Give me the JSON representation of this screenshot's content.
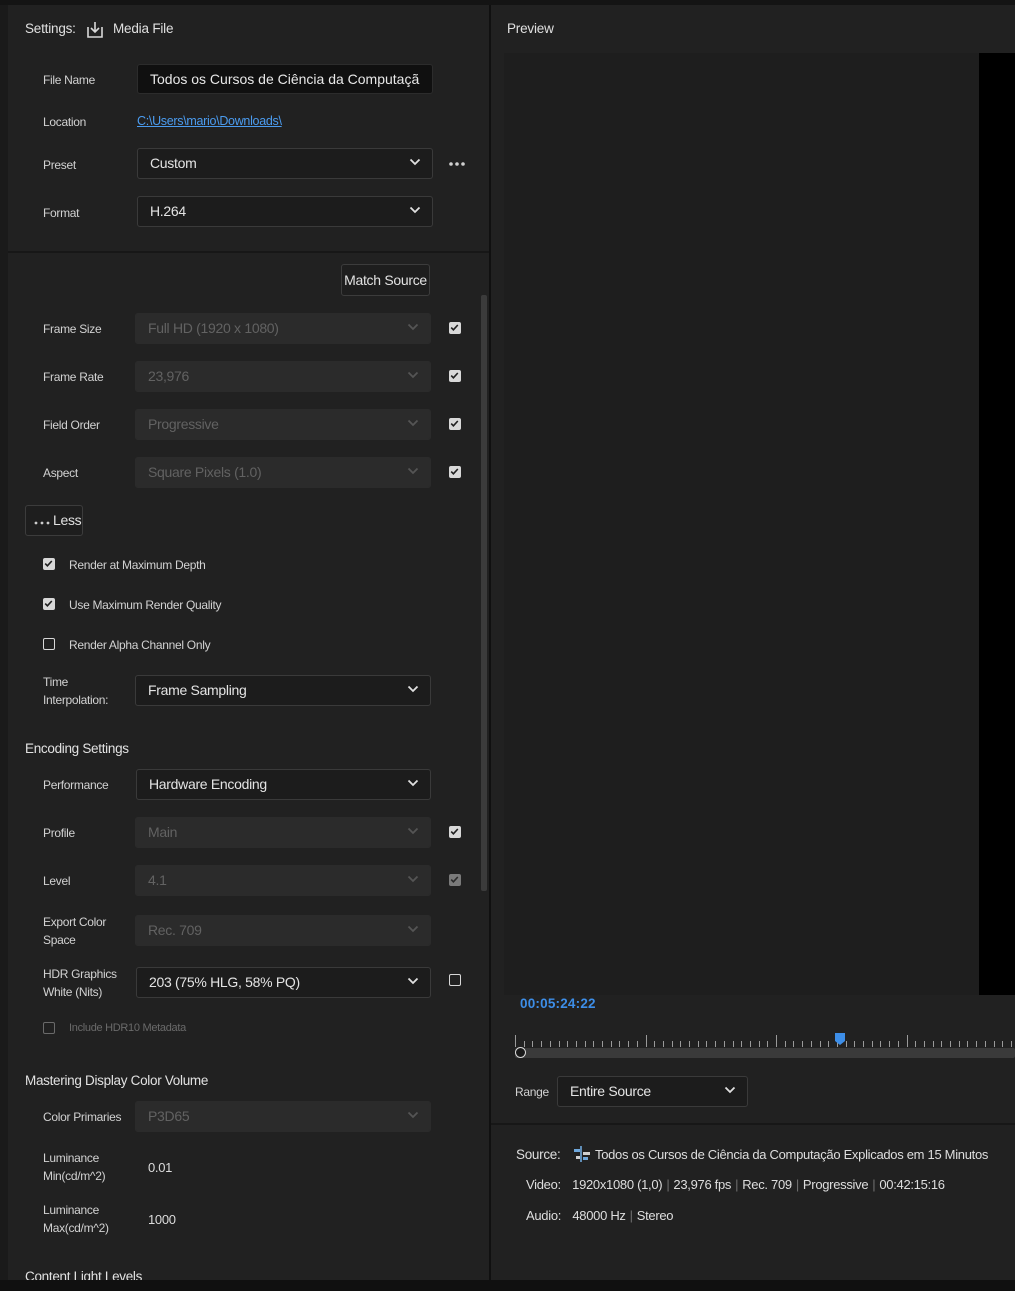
{
  "header": {
    "settings_label": "Settings:",
    "media_file_label": "Media File",
    "preview_title": "Preview"
  },
  "file": {
    "file_name_label": "File Name",
    "file_name_value": "Todos os Cursos de Ciência da Computaçã",
    "location_label": "Location",
    "location_value": "C:\\Users\\mario\\Downloads\\",
    "preset_label": "Preset",
    "preset_value": "Custom",
    "format_label": "Format",
    "format_value": "H.264"
  },
  "video": {
    "match_source_label": "Match Source",
    "frame_size_label": "Frame Size",
    "frame_size_value": "Full HD (1920 x 1080)",
    "frame_size_checked": true,
    "frame_rate_label": "Frame Rate",
    "frame_rate_value": "23,976",
    "frame_rate_checked": true,
    "field_order_label": "Field Order",
    "field_order_value": "Progressive",
    "field_order_checked": true,
    "aspect_label": "Aspect",
    "aspect_value": "Square Pixels (1.0)",
    "aspect_checked": true,
    "less_label": "Less",
    "render_max_depth_label": "Render at Maximum Depth",
    "render_max_depth_checked": true,
    "max_render_quality_label": "Use Maximum Render Quality",
    "max_render_quality_checked": true,
    "render_alpha_label": "Render Alpha Channel Only",
    "render_alpha_checked": false,
    "time_interp_label_1": "Time",
    "time_interp_label_2": "Interpolation:",
    "time_interp_value": "Frame Sampling"
  },
  "encoding": {
    "title": "Encoding Settings",
    "performance_label": "Performance",
    "performance_value": "Hardware Encoding",
    "profile_label": "Profile",
    "profile_value": "Main",
    "profile_checked": true,
    "level_label": "Level",
    "level_value": "4.1",
    "level_checked": true,
    "export_color_label_1": "Export Color",
    "export_color_label_2": "Space",
    "export_color_value": "Rec. 709",
    "hdr_label_1": "HDR Graphics",
    "hdr_label_2": "White (Nits)",
    "hdr_value": "203 (75% HLG, 58% PQ)",
    "hdr_checked": false,
    "hdr10_label": "Include HDR10 Metadata",
    "hdr10_checked": false
  },
  "mastering": {
    "title": "Mastering Display Color Volume",
    "color_primaries_label": "Color Primaries",
    "color_primaries_value": "P3D65",
    "lum_min_label_1": "Luminance",
    "lum_min_label_2": "Min(cd/m^2)",
    "lum_min_value": "0.01",
    "lum_max_label_1": "Luminance",
    "lum_max_label_2": "Max(cd/m^2)",
    "lum_max_value": "1000"
  },
  "content_light": {
    "title": "Content Light Levels"
  },
  "preview": {
    "timecode": "00:05:24:22",
    "playhead_fraction": 0.65,
    "range_label": "Range",
    "range_value": "Entire Source"
  },
  "source": {
    "source_label": "Source:",
    "source_name": "Todos os Cursos de Ciência da Computação Explicados em 15 Minutos",
    "video_label": "Video:",
    "video_resolution": "1920x1080 (1,0)",
    "video_fps": "23,976 fps",
    "video_color": "Rec. 709",
    "video_scan": "Progressive",
    "video_duration": "00:42:15:16",
    "audio_label": "Audio:",
    "audio_rate": "48000 Hz",
    "audio_channels": "Stereo"
  },
  "colors": {
    "accent": "#4b9cf0",
    "panel_bg": "#212121",
    "timecode": "#3d8ee8"
  }
}
